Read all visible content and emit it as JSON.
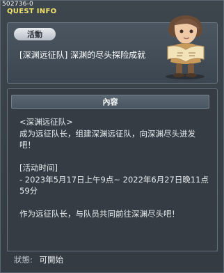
{
  "quest": {
    "id": "502736-0",
    "window_title": "QUEST INFO",
    "badge": "活動",
    "name": "[深渊远征队] 深渊的尽头探险成就"
  },
  "content": {
    "tab_label": "內容",
    "lines": [
      "<深渊远征队>",
      "成为远征队长，组建深渊远征队，向深渊尽头进发",
      "吧！",
      "",
      " [活动时间]",
      "  - 2023年5月17日上午9点~ 2022年6月27日晚11点",
      "59分",
      "",
      "作为远征队长，与队员共同前往深渊尽头吧！"
    ]
  },
  "status": {
    "label": "狀態:",
    "value": "可開始"
  },
  "colors": {
    "title_yellow": "#f1e36a",
    "panel": "#353c43",
    "border": "#65717c"
  },
  "icons": {
    "npc_portrait": "explorer-npc-holding-map"
  }
}
